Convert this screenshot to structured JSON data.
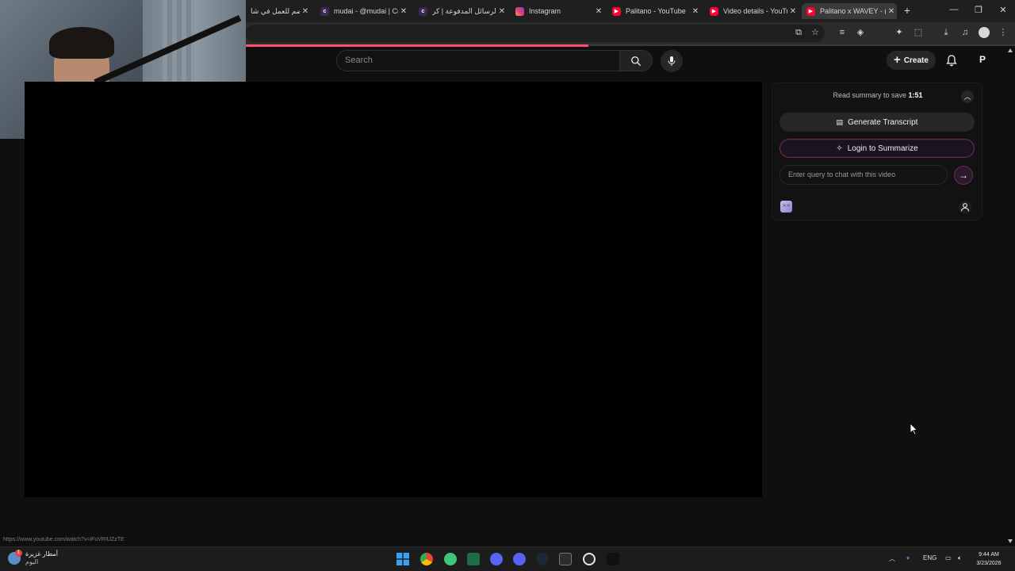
{
  "browser": {
    "tabs": [
      {
        "title": "انضم للعمل في شا",
        "icon": "cropped-favicon"
      },
      {
        "title": "mudai - @mudai | Cr",
        "icon": "c-favicon"
      },
      {
        "title": "الرسائل المدفوعة | كر",
        "icon": "c-favicon"
      },
      {
        "title": "Instagram",
        "icon": "instagram-favicon"
      },
      {
        "title": "Palitano - YouTube",
        "icon": "youtube-favicon"
      },
      {
        "title": "Video details - YouTu",
        "icon": "youtube-favicon"
      },
      {
        "title": "Palitano x WAVEY - (",
        "icon": "youtube-favicon",
        "active": true
      }
    ],
    "new_tab": "+",
    "close_glyph": "✕",
    "window_controls": {
      "minimize": "—",
      "maximize": "❐",
      "close": "✕"
    }
  },
  "masthead": {
    "search_placeholder": "Search",
    "create_label": "Create",
    "avatar_letter": "P"
  },
  "summary_panel": {
    "header_prefix": "Read summary to save ",
    "header_time": "1:51",
    "generate_transcript": "Generate Transcript",
    "login_to_summarize": "Login to Summarize",
    "query_placeholder": "Enter query to chat with this video",
    "logo_text": ">.<"
  },
  "status_url": "https://www.youtube.com/watch?v=iFuVRIUZzTE",
  "taskbar": {
    "weather_title": "أمطار غزيرة",
    "weather_sub": "اليوم",
    "weather_badge": "1",
    "lang": "ENG",
    "time": "9:44 AM",
    "date": "3/23/2026",
    "apps": [
      "start",
      "chrome",
      "helper",
      "excel",
      "discord",
      "discord-2",
      "steam",
      "terminal",
      "app-x",
      "capcut"
    ]
  },
  "colors": {
    "accent": "#ff4e6e",
    "panel_border": "#6b2a5a",
    "background": "#0f0f0f"
  }
}
